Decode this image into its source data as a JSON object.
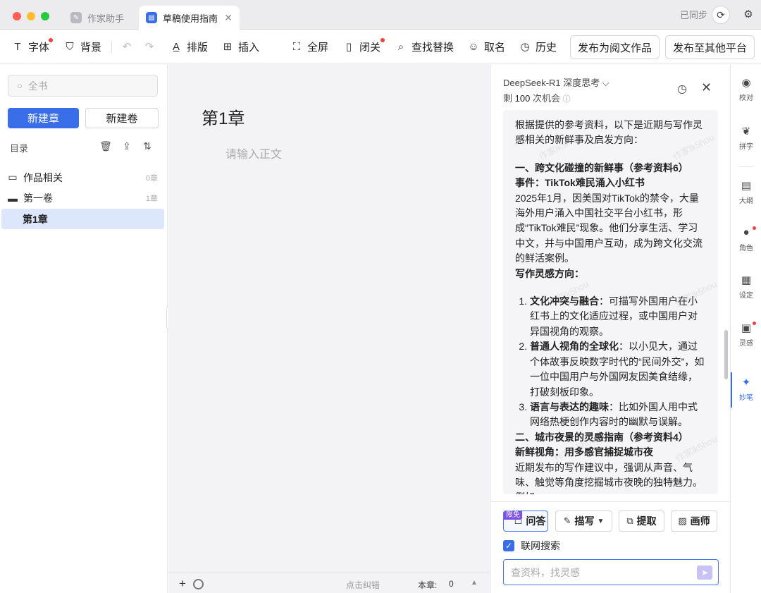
{
  "titlebar": {
    "tabs": [
      {
        "label": "作家助手",
        "icon": "feather-icon"
      },
      {
        "label": "草稿使用指南",
        "icon": "document-icon"
      }
    ],
    "sync_status": "已同步"
  },
  "toolbar": {
    "items": [
      {
        "label": "字体",
        "icon": "T"
      },
      {
        "label": "背景",
        "icon": "shirt-icon"
      },
      {
        "label": "排版",
        "icon": "format-icon"
      },
      {
        "label": "插入",
        "icon": "plus-box-icon"
      },
      {
        "label": "全屏",
        "icon": "fullscreen-icon"
      },
      {
        "label": "闭关",
        "icon": "door-icon"
      },
      {
        "label": "查找替换",
        "icon": "find-replace-icon"
      },
      {
        "label": "取名",
        "icon": "person-icon"
      },
      {
        "label": "历史",
        "icon": "history-icon"
      }
    ],
    "publish_yuewen": "发布为阅文作品",
    "publish_other": "发布至其他平台"
  },
  "sidebar": {
    "search_placeholder": "全书",
    "new_chapter": "新建章",
    "new_volume": "新建卷",
    "toc_label": "目录",
    "tree": [
      {
        "label": "作品相关",
        "count": "0章"
      },
      {
        "label": "第一卷",
        "count": "1章"
      },
      {
        "label": "第1章",
        "count": ""
      }
    ]
  },
  "editor": {
    "chapter_title": "第1章",
    "body_placeholder": "请输入正文",
    "status": {
      "fix_hint": "点击纠错",
      "word_count_label": "本章:",
      "word_count_value": "0"
    }
  },
  "ai_panel": {
    "model": "DeepSeek-R1 深度思考",
    "quota_prefix": "剩",
    "quota_value": "100",
    "quota_suffix": "次机会",
    "watermark": "作家lk5hou",
    "answer": {
      "intro": "根据提供的参考资料，以下是近期与写作灵感相关的新鲜事及启发方向：",
      "s1_heading": "一、跨文化碰撞的新鲜事（参考资料6）",
      "s1_event": "事件：TikTok难民涌入小红书",
      "s1_body": "2025年1月，因美国对TikTok的禁令，大量海外用户涌入中国社交平台小红书，形成“TikTok难民”现象。他们分享生活、学习中文，并与中国用户互动，成为跨文化交流的鲜活案例。",
      "s1_direction": "写作灵感方向：",
      "s1_points": [
        {
          "title": "文化冲突与融合",
          "text": "：可描写外国用户在小红书上的文化适应过程，或中国用户对异国视角的观察。"
        },
        {
          "title": "普通人视角的全球化",
          "text": "：以小见大，通过个体故事反映数字时代的“民间外交”，如一位中国用户与外国网友因美食结缘，打破刻板印象。"
        },
        {
          "title": "语言与表达的趣味",
          "text": "：比如外国人用中式网络热梗创作内容时的幽默与误解。"
        }
      ],
      "s2_heading": "二、城市夜景的灵感指南（参考资料4）",
      "s2_sub": "新鲜视角：用多感官捕捉城市夜",
      "s2_body": "近期发布的写作建议中，强调从声音、气味、触觉等角度挖掘城市夜晚的独特魅力。例如："
    },
    "modes": [
      {
        "label": "问答",
        "badge": "限免"
      },
      {
        "label": "描写"
      },
      {
        "label": "提取"
      },
      {
        "label": "画师"
      }
    ],
    "web_search_label": "联网搜索",
    "web_search_checked": true,
    "input_placeholder": "查资料，找灵感"
  },
  "rail": {
    "items": [
      "校对",
      "拼字",
      "大纲",
      "角色",
      "设定",
      "灵感",
      "妙笔"
    ]
  },
  "colors": {
    "accent": "#3a6ee8",
    "notification": "#f03e3e",
    "badge": "#7b4ee8"
  }
}
